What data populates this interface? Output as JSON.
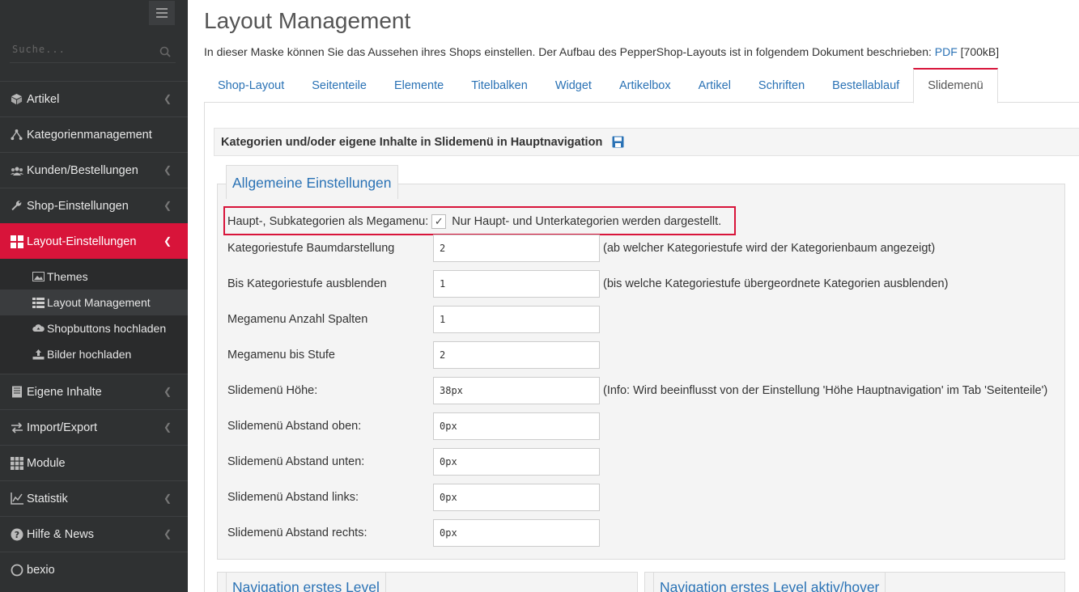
{
  "sidebar": {
    "search_placeholder": "Suche...",
    "items": [
      {
        "label": "Artikel",
        "icon": "cube-icon",
        "has_chevron": true
      },
      {
        "label": "Kategorienmanagement",
        "icon": "sitemap-icon",
        "has_chevron": false
      },
      {
        "label": "Kunden/Bestellungen",
        "icon": "users-icon",
        "has_chevron": true
      },
      {
        "label": "Shop-Einstellungen",
        "icon": "wrench-icon",
        "has_chevron": true
      },
      {
        "label": "Layout-Einstellungen",
        "icon": "layout-icon",
        "has_chevron": true,
        "active": true
      }
    ],
    "subitems": [
      {
        "label": "Themes",
        "icon": "image-icon"
      },
      {
        "label": "Layout Management",
        "icon": "list-icon",
        "active": true
      },
      {
        "label": "Shopbuttons hochladen",
        "icon": "cloud-upload-icon"
      },
      {
        "label": "Bilder hochladen",
        "icon": "upload-icon"
      }
    ],
    "items_after": [
      {
        "label": "Eigene Inhalte",
        "icon": "book-icon",
        "has_chevron": true
      },
      {
        "label": "Import/Export",
        "icon": "exchange-icon",
        "has_chevron": true
      },
      {
        "label": "Module",
        "icon": "grid-icon",
        "has_chevron": false
      },
      {
        "label": "Statistik",
        "icon": "chart-icon",
        "has_chevron": true
      },
      {
        "label": "Hilfe & News",
        "icon": "help-icon",
        "has_chevron": true
      },
      {
        "label": "bexio",
        "icon": "circle-icon",
        "has_chevron": false
      }
    ]
  },
  "main": {
    "title": "Layout Management",
    "description_prefix": "In dieser Maske können Sie das Aussehen ihres Shops einstellen. Der Aufbau des PepperShop-Layouts ist in folgendem Dokument beschrieben:",
    "description_link": "PDF",
    "description_suffix": "[700kB]",
    "tabs": [
      "Shop-Layout",
      "Seitenteile",
      "Elemente",
      "Titelbalken",
      "Widget",
      "Artikelbox",
      "Artikel",
      "Schriften",
      "Bestellablauf",
      "Slidemenü"
    ],
    "active_tab": "Slidemenü",
    "section_title": "Kategorien und/oder eigene Inhalte in Slidemenü in Hauptnavigation",
    "fieldset_legend": "Allgemeine Einstellungen",
    "checkbox": {
      "label": "Haupt-, Subkategorien als Megamenu:",
      "checked": true,
      "hint": "Nur Haupt- und Unterkategorien werden dargestellt."
    },
    "fields": [
      {
        "label": "Kategoriestufe Baumdarstellung",
        "value": "2",
        "hint": "(ab welcher Kategoriestufe wird der Kategorienbaum angezeigt)"
      },
      {
        "label": "Bis Kategoriestufe ausblenden",
        "value": "1",
        "hint": "(bis welche Kategoriestufe übergeordnete Kategorien ausblenden)"
      },
      {
        "label": "Megamenu Anzahl Spalten",
        "value": "1",
        "hint": ""
      },
      {
        "label": "Megamenu bis Stufe",
        "value": "2",
        "hint": ""
      },
      {
        "label": "Slidemenü Höhe:",
        "value": "38px",
        "hint": "(Info: Wird beeinflusst von der Einstellung 'Höhe Hauptnavigation' im Tab 'Seitenteile')"
      },
      {
        "label": "Slidemenü Abstand oben:",
        "value": "0px",
        "hint": ""
      },
      {
        "label": "Slidemenü Abstand unten:",
        "value": "0px",
        "hint": ""
      },
      {
        "label": "Slidemenü Abstand links:",
        "value": "0px",
        "hint": ""
      },
      {
        "label": "Slidemenü Abstand rechts:",
        "value": "0px",
        "hint": ""
      }
    ],
    "lower_legends": [
      "Navigation erstes Level",
      "Navigation erstes Level aktiv/hover"
    ]
  },
  "colors": {
    "accent": "#d8143a",
    "link": "#2a72b5",
    "sidebar_bg": "#2f3132"
  }
}
